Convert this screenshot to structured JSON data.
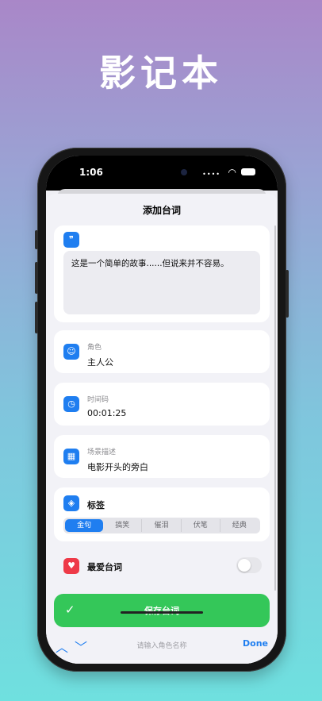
{
  "hero": {
    "title": "影记本"
  },
  "status": {
    "time": "1:06"
  },
  "nav": {
    "title": "添加台词"
  },
  "line_card": {
    "icon": "quote-icon",
    "text": "这是一个简单的故事......但说来并不容易。"
  },
  "character": {
    "icon": "person-icon",
    "label": "角色",
    "value": "主人公"
  },
  "timecode": {
    "icon": "clock-icon",
    "label": "时间码",
    "value": "00:01:25"
  },
  "scene": {
    "icon": "film-icon",
    "label": "场景描述",
    "value": "电影开头的旁白"
  },
  "tags": {
    "icon": "tag-icon",
    "label": "标签",
    "options": [
      "金句",
      "搞笑",
      "催泪",
      "伏笔",
      "经典"
    ],
    "selected": "金句"
  },
  "favorite": {
    "icon": "heart-icon",
    "label": "最爱台词",
    "enabled": false
  },
  "save": {
    "label": "保存台词",
    "icon": "checkmark-icon"
  },
  "keyboard_bar": {
    "placeholder": "请输入角色名称",
    "done": "Done"
  },
  "colors": {
    "accent": "#1f7ef0",
    "save": "#34c759",
    "favorite": "#ee3a48"
  }
}
